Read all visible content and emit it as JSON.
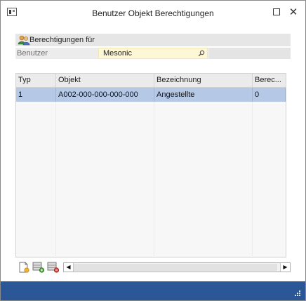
{
  "window": {
    "title": "Benutzer Objekt Berechtigungen",
    "icon": "app-window-icon",
    "controls": {
      "maximize": "maximize-icon",
      "close_label": "✕"
    }
  },
  "group": {
    "title": "Berechtigungen für",
    "icon": "users-icon"
  },
  "user_field": {
    "label": "Benutzer",
    "value": "Mesonic",
    "icon": "lookup-magnifier-icon"
  },
  "grid": {
    "columns": [
      "Typ",
      "Objekt",
      "Bezeichnung",
      "Berec..."
    ],
    "rows": [
      {
        "typ": "1",
        "objekt": "A002-000-000-000-000",
        "bezeichnung": "Angestellte",
        "berechtigung": "0"
      }
    ],
    "selected_row_color": "#b5c9e6"
  },
  "toolbar": {
    "buttons": [
      "new-record-icon",
      "add-record-icon",
      "delete-record-icon"
    ]
  },
  "scrollbar": {
    "left_arrow": "◀",
    "right_arrow": "▶"
  },
  "colors": {
    "statusbar": "#2b5797",
    "input_bg": "#fdf7d5"
  }
}
